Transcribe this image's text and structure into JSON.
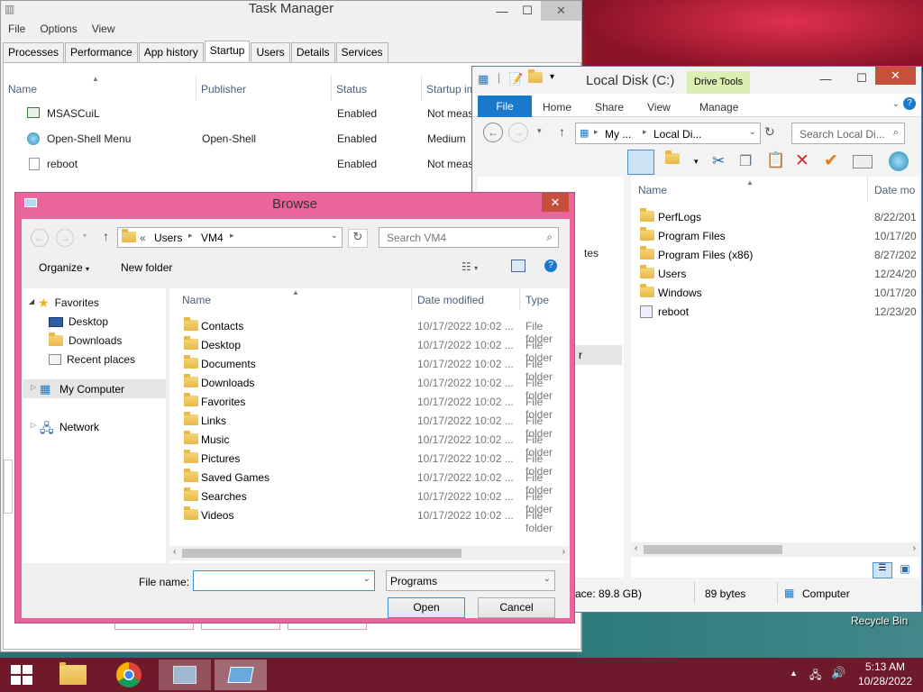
{
  "task_manager": {
    "title": "Task Manager",
    "menu": [
      "File",
      "Options",
      "View"
    ],
    "tabs": [
      "Processes",
      "Performance",
      "App history",
      "Startup",
      "Users",
      "Details",
      "Services"
    ],
    "active_tab": "Startup",
    "columns": [
      "Name",
      "Publisher",
      "Status",
      "Startup im"
    ],
    "rows": [
      {
        "name": "MSASCuiL",
        "publisher": "",
        "status": "Enabled",
        "impact": "Not meas"
      },
      {
        "name": "Open-Shell Menu",
        "publisher": "Open-Shell",
        "status": "Enabled",
        "impact": "Medium"
      },
      {
        "name": "reboot",
        "publisher": "",
        "status": "Enabled",
        "impact": "Not meas"
      }
    ]
  },
  "explorer": {
    "title": "Local Disk (C:)",
    "drive_tools": "Drive Tools",
    "ribbon_tabs": [
      "File",
      "Home",
      "Share",
      "View",
      "Manage"
    ],
    "breadcrumb": [
      "My ...",
      "Local Di..."
    ],
    "search_placeholder": "Search Local Di...",
    "columns": [
      "Name",
      "Date mo"
    ],
    "items": [
      {
        "name": "PerfLogs",
        "date": "8/22/201"
      },
      {
        "name": "Program Files",
        "date": "10/17/20"
      },
      {
        "name": "Program Files (x86)",
        "date": "8/27/202"
      },
      {
        "name": "Users",
        "date": "12/24/20"
      },
      {
        "name": "Windows",
        "date": "10/17/20"
      },
      {
        "name": "reboot",
        "date": "12/23/20"
      }
    ],
    "left_fragments": [
      "tes",
      "r"
    ],
    "status": {
      "free": "ace: 89.8 GB)",
      "size": "89 bytes",
      "location": "Computer"
    }
  },
  "browse": {
    "title": "Browse",
    "breadcrumb": [
      "Users",
      "VM4"
    ],
    "breadcrumb_prefix": "«",
    "search_placeholder": "Search VM4",
    "organize": "Organize",
    "new_folder": "New folder",
    "nav": {
      "favorites": "Favorites",
      "desktop": "Desktop",
      "downloads": "Downloads",
      "recent": "Recent places",
      "computer": "My Computer",
      "network": "Network"
    },
    "columns": [
      "Name",
      "Date modified",
      "Type"
    ],
    "files": [
      {
        "name": "Contacts",
        "date": "10/17/2022 10:02 ...",
        "type": "File folder"
      },
      {
        "name": "Desktop",
        "date": "10/17/2022 10:02 ...",
        "type": "File folder"
      },
      {
        "name": "Documents",
        "date": "10/17/2022 10:02 ...",
        "type": "File folder"
      },
      {
        "name": "Downloads",
        "date": "10/17/2022 10:02 ...",
        "type": "File folder"
      },
      {
        "name": "Favorites",
        "date": "10/17/2022 10:02 ...",
        "type": "File folder"
      },
      {
        "name": "Links",
        "date": "10/17/2022 10:02 ...",
        "type": "File folder"
      },
      {
        "name": "Music",
        "date": "10/17/2022 10:02 ...",
        "type": "File folder"
      },
      {
        "name": "Pictures",
        "date": "10/17/2022 10:02 ...",
        "type": "File folder"
      },
      {
        "name": "Saved Games",
        "date": "10/17/2022 10:02 ...",
        "type": "File folder"
      },
      {
        "name": "Searches",
        "date": "10/17/2022 10:02 ...",
        "type": "File folder"
      },
      {
        "name": "Videos",
        "date": "10/17/2022 10:02 ...",
        "type": "File folder"
      }
    ],
    "file_name_label": "File name:",
    "file_name_value": "",
    "file_type": "Programs",
    "open": "Open",
    "cancel": "Cancel"
  },
  "desktop": {
    "recycle_bin": "Recycle Bin"
  },
  "taskbar": {
    "time": "5:13 AM",
    "date": "10/28/2022"
  }
}
